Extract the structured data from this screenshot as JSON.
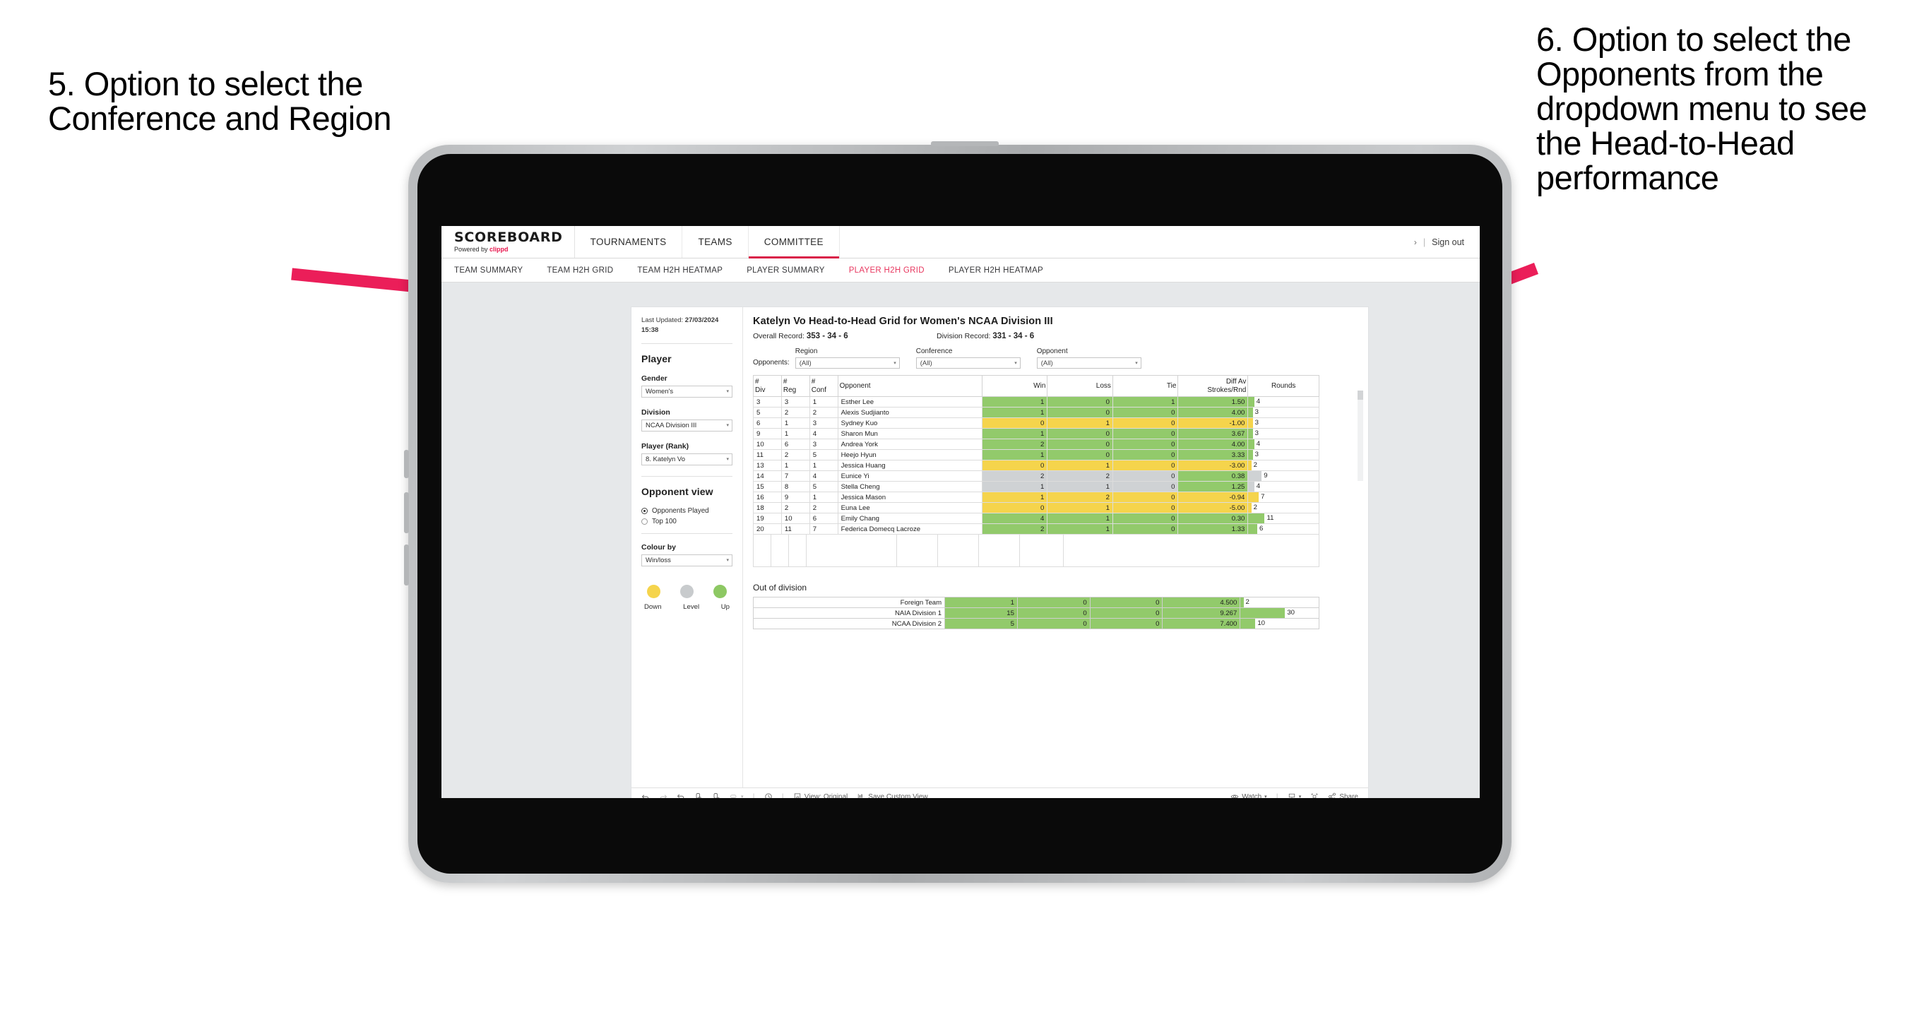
{
  "annotations": {
    "left": "5. Option to select the Conference and Region",
    "right": "6. Option to select the Opponents from the dropdown menu to see the Head-to-Head performance",
    "arrow_color": "#EB1E59"
  },
  "header": {
    "brand_title": "SCOREBOARD",
    "brand_sub_prefix": "Powered by ",
    "brand_sub_brand": "clippd",
    "nav": [
      {
        "label": "TOURNAMENTS",
        "active": false
      },
      {
        "label": "TEAMS",
        "active": false
      },
      {
        "label": "COMMITTEE",
        "active": true
      }
    ],
    "chevron": "›",
    "separator": "|",
    "sign_out": "Sign out",
    "accent": "#D91F48"
  },
  "subnav": {
    "items": [
      {
        "label": "TEAM SUMMARY",
        "active": false
      },
      {
        "label": "TEAM H2H GRID",
        "active": false
      },
      {
        "label": "TEAM H2H HEATMAP",
        "active": false
      },
      {
        "label": "PLAYER SUMMARY",
        "active": false
      },
      {
        "label": "PLAYER H2H GRID",
        "active": true
      },
      {
        "label": "PLAYER H2H HEATMAP",
        "active": false
      }
    ],
    "active_color": "#E8375F"
  },
  "sidebar": {
    "last_updated_label": "Last Updated: ",
    "last_updated_value": "27/03/2024",
    "last_updated_time": "15:38",
    "section_player": "Player",
    "gender_label": "Gender",
    "gender_value": "Women's",
    "division_label": "Division",
    "division_value": "NCAA Division III",
    "player_label": "Player (Rank)",
    "player_value": "8. Katelyn Vo",
    "opponent_view_label": "Opponent view",
    "opponent_view_options": [
      {
        "label": "Opponents Played",
        "selected": true
      },
      {
        "label": "Top 100",
        "selected": false
      }
    ],
    "colour_by_label": "Colour by",
    "colour_by_value": "Win/loss",
    "legend": [
      {
        "label": "Down",
        "color": "#F5D44C"
      },
      {
        "label": "Level",
        "color": "#C8CBCD"
      },
      {
        "label": "Up",
        "color": "#8DC863"
      }
    ],
    "caret": "▾"
  },
  "main": {
    "title": "Katelyn Vo Head-to-Head Grid for Women's NCAA Division III",
    "overall_record_label": "Overall Record: ",
    "overall_record_value": "353 -  34 - 6",
    "division_record_label": "Division Record: ",
    "division_record_value": "331 -  34 - 6",
    "opponents_label": "Opponents:",
    "filters": [
      {
        "label": "Region",
        "value": "(All)"
      },
      {
        "label": "Conference",
        "value": "(All)"
      },
      {
        "label": "Opponent",
        "value": "(All)"
      }
    ],
    "caret": "▾",
    "out_of_division_title": "Out of division"
  },
  "chart_data": {
    "type": "table",
    "title": "Katelyn Vo Head-to-Head Grid for Women's NCAA Division III",
    "columns": [
      "# Div",
      "# Reg",
      "# Conf",
      "Opponent",
      "Win",
      "Loss",
      "Tie",
      "Diff Av Strokes/Rnd",
      "Rounds"
    ],
    "column_header_lines": [
      [
        "#",
        "Div"
      ],
      [
        "#",
        "Reg"
      ],
      [
        "#",
        "Conf"
      ],
      [
        "Opponent"
      ],
      [
        "Win"
      ],
      [
        "Loss"
      ],
      [
        "Tie"
      ],
      [
        "Diff Av",
        "Strokes/Rnd"
      ],
      [
        "Rounds"
      ]
    ],
    "rounds_axis_max": 30,
    "rows": [
      {
        "div": "3",
        "reg": "3",
        "conf": "1",
        "opponent": "Esther Lee",
        "win": "1",
        "loss": "0",
        "tie": "1",
        "diff": "1.50",
        "rounds": "4",
        "rounds_value": 4,
        "color": "g"
      },
      {
        "div": "5",
        "reg": "2",
        "conf": "2",
        "opponent": "Alexis Sudjianto",
        "win": "1",
        "loss": "0",
        "tie": "0",
        "diff": "4.00",
        "rounds": "3",
        "rounds_value": 3,
        "color": "g"
      },
      {
        "div": "6",
        "reg": "1",
        "conf": "3",
        "opponent": "Sydney Kuo",
        "win": "0",
        "loss": "1",
        "tie": "0",
        "diff": "-1.00",
        "rounds": "3",
        "rounds_value": 3,
        "color": "y"
      },
      {
        "div": "9",
        "reg": "1",
        "conf": "4",
        "opponent": "Sharon Mun",
        "win": "1",
        "loss": "0",
        "tie": "0",
        "diff": "3.67",
        "rounds": "3",
        "rounds_value": 3,
        "color": "g"
      },
      {
        "div": "10",
        "reg": "6",
        "conf": "3",
        "opponent": "Andrea York",
        "win": "2",
        "loss": "0",
        "tie": "0",
        "diff": "4.00",
        "rounds": "4",
        "rounds_value": 4,
        "color": "g"
      },
      {
        "div": "11",
        "reg": "2",
        "conf": "5",
        "opponent": "Heejo Hyun",
        "win": "1",
        "loss": "0",
        "tie": "0",
        "diff": "3.33",
        "rounds": "3",
        "rounds_value": 3,
        "color": "g"
      },
      {
        "div": "13",
        "reg": "1",
        "conf": "1",
        "opponent": "Jessica Huang",
        "win": "0",
        "loss": "1",
        "tie": "0",
        "diff": "-3.00",
        "rounds": "2",
        "rounds_value": 2,
        "color": "y"
      },
      {
        "div": "14",
        "reg": "7",
        "conf": "4",
        "opponent": "Eunice Yi",
        "win": "2",
        "loss": "2",
        "tie": "0",
        "diff": "0.38",
        "rounds": "9",
        "rounds_value": 9,
        "color": "n",
        "diff_color": "g"
      },
      {
        "div": "15",
        "reg": "8",
        "conf": "5",
        "opponent": "Stella Cheng",
        "win": "1",
        "loss": "1",
        "tie": "0",
        "diff": "1.25",
        "rounds": "4",
        "rounds_value": 4,
        "color": "n",
        "diff_color": "g"
      },
      {
        "div": "16",
        "reg": "9",
        "conf": "1",
        "opponent": "Jessica Mason",
        "win": "1",
        "loss": "2",
        "tie": "0",
        "diff": "-0.94",
        "rounds": "7",
        "rounds_value": 7,
        "color": "y"
      },
      {
        "div": "18",
        "reg": "2",
        "conf": "2",
        "opponent": "Euna Lee",
        "win": "0",
        "loss": "1",
        "tie": "0",
        "diff": "-5.00",
        "rounds": "2",
        "rounds_value": 2,
        "color": "y"
      },
      {
        "div": "19",
        "reg": "10",
        "conf": "6",
        "opponent": "Emily Chang",
        "win": "4",
        "loss": "1",
        "tie": "0",
        "diff": "0.30",
        "rounds": "11",
        "rounds_value": 11,
        "color": "g"
      },
      {
        "div": "20",
        "reg": "11",
        "conf": "7",
        "opponent": "Federica Domecq Lacroze",
        "win": "2",
        "loss": "1",
        "tie": "0",
        "diff": "1.33",
        "rounds": "6",
        "rounds_value": 6,
        "color": "g"
      }
    ],
    "out_of_division": {
      "title": "Out of division",
      "rows": [
        {
          "name": "Foreign Team",
          "win": "1",
          "loss": "0",
          "tie": "0",
          "diff": "4.500",
          "rounds": "2",
          "rounds_value": 2,
          "color": "g"
        },
        {
          "name": "NAIA Division 1",
          "win": "15",
          "loss": "0",
          "tie": "0",
          "diff": "9.267",
          "rounds": "30",
          "rounds_value": 30,
          "color": "g"
        },
        {
          "name": "NCAA Division 2",
          "win": "5",
          "loss": "0",
          "tie": "0",
          "diff": "7.400",
          "rounds": "10",
          "rounds_value": 10,
          "color": "g"
        }
      ]
    },
    "palette": {
      "g": "#92CA6B",
      "y": "#F5D44C",
      "n": "#CFD2D4"
    }
  },
  "toolbar": {
    "undo": "undo-icon",
    "redo": "redo-icon",
    "revert": "revert-icon",
    "refresh": "refresh-icon",
    "pause": "pause-icon",
    "export": "export-icon",
    "view_label": "View: Original",
    "save_label": "Save Custom View",
    "watch_label": "Watch",
    "share_label": "Share",
    "caret": "▾",
    "separator": "|"
  }
}
